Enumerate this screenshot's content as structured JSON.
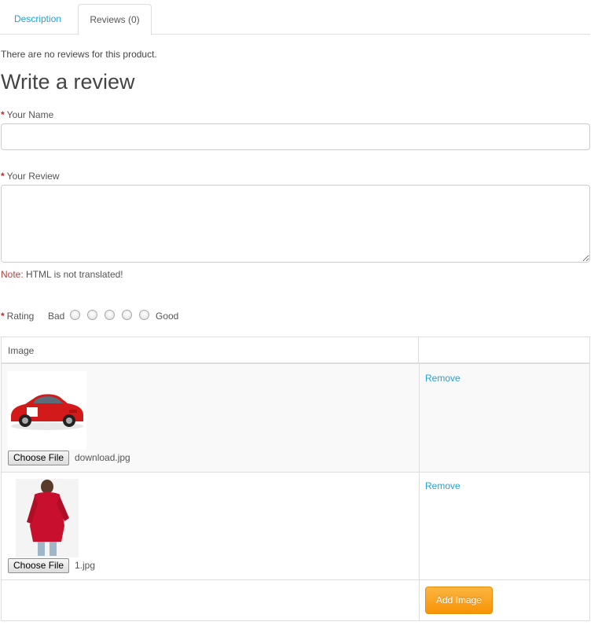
{
  "tabs": [
    {
      "label": "Description",
      "active": false
    },
    {
      "label": "Reviews (0)",
      "active": true
    }
  ],
  "no_reviews_text": "There are no reviews for this product.",
  "title": "Write a review",
  "required_marker": "*",
  "form": {
    "name_label": "Your Name",
    "name_value": "",
    "review_label": "Your Review",
    "review_value": "",
    "note_key": "Note:",
    "note_text": " HTML is not translated!",
    "rating_label": "Rating",
    "rating_bad": "Bad",
    "rating_good": "Good",
    "rating_options": 5
  },
  "image_table": {
    "header": "Image",
    "rows": [
      {
        "thumb_icon": "red-car-icon",
        "choose_label": "Choose File",
        "file_name": "download.jpg",
        "remove_label": "Remove"
      },
      {
        "thumb_icon": "red-coat-person-icon",
        "choose_label": "Choose File",
        "file_name": "1.jpg",
        "remove_label": "Remove"
      }
    ],
    "add_label": "Add Image"
  },
  "colors": {
    "link": "#23a1d1",
    "required": "#e02020",
    "add_button": "#f89406",
    "border": "#dddddd"
  }
}
